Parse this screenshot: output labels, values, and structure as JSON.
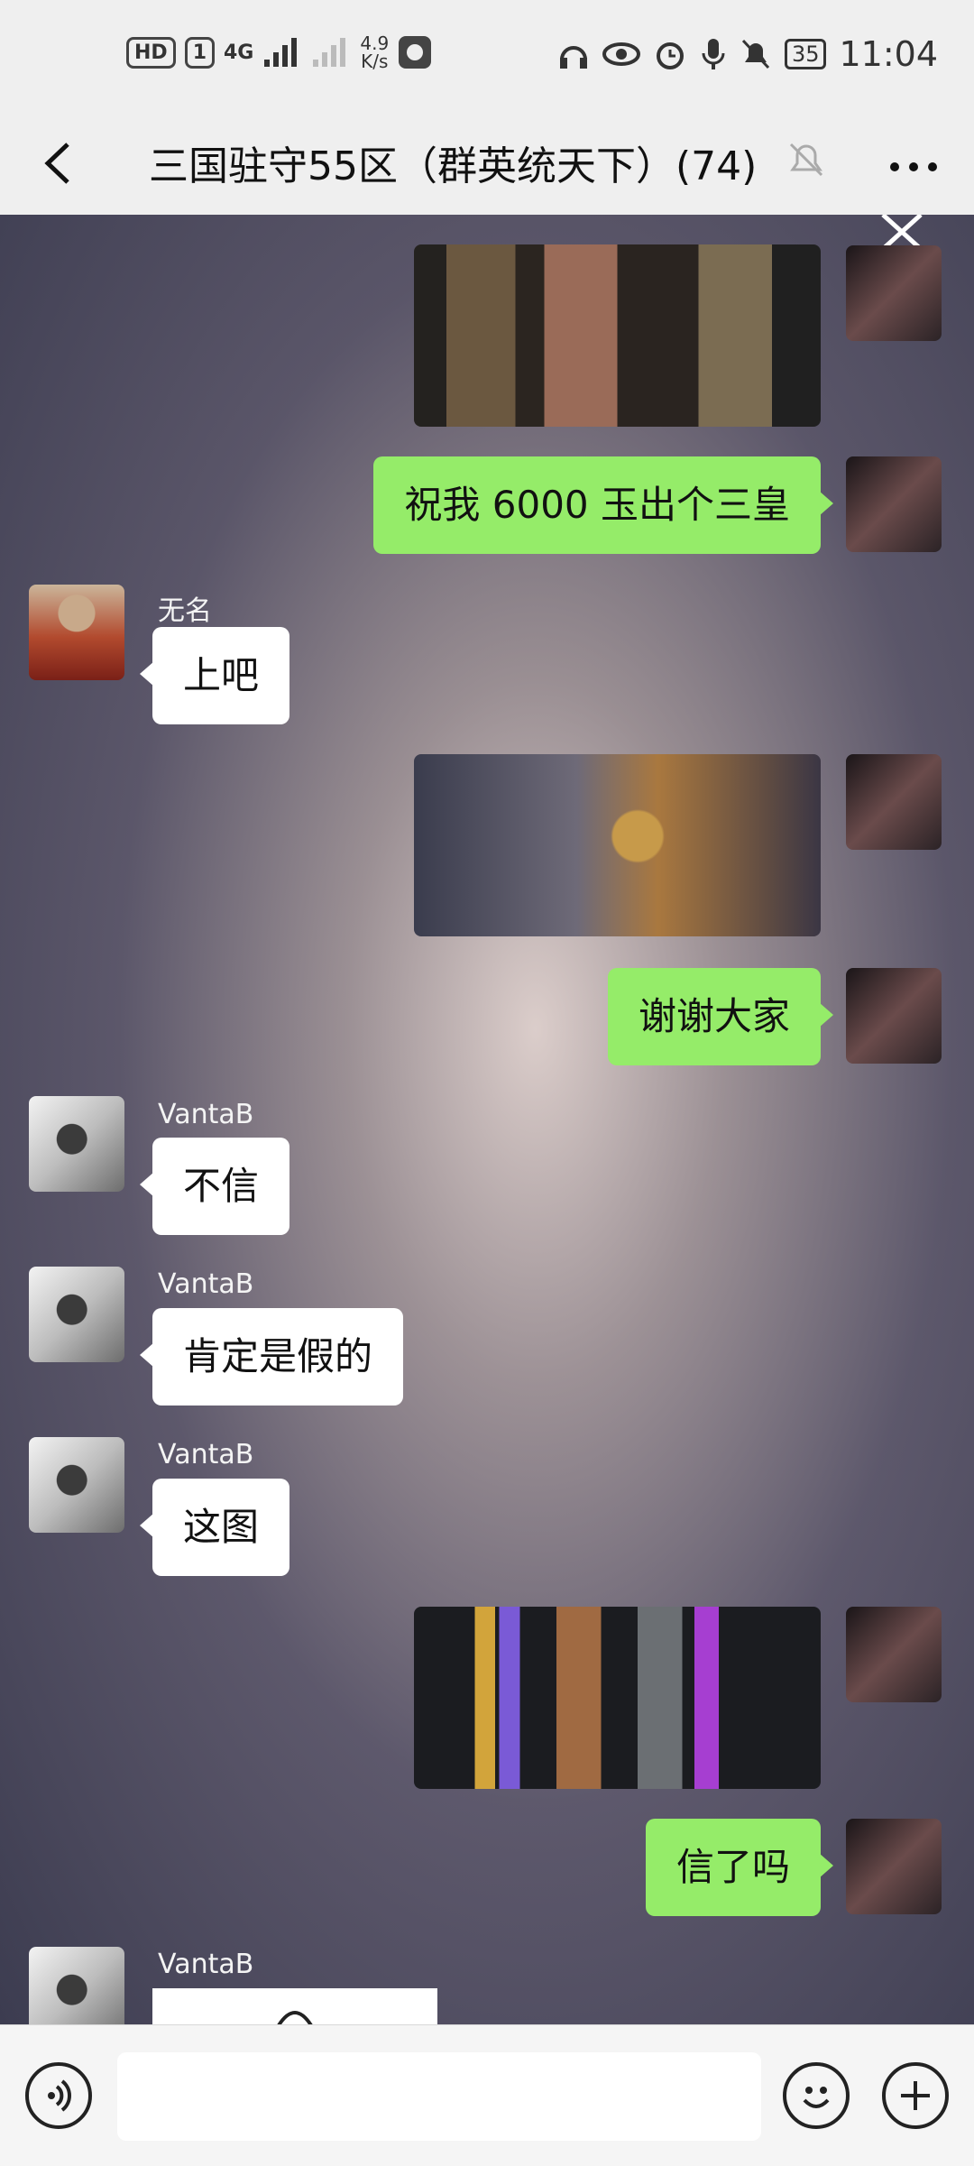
{
  "status_bar": {
    "hd": "HD",
    "sim": "1",
    "network_type": "4G",
    "speed_value": "4.9",
    "speed_unit": "K/s",
    "battery": "35",
    "time": "11:04"
  },
  "header": {
    "title": "三国驻守55区（群英统天下）(74)",
    "back_icon": "chevron-left-icon",
    "mute_icon": "bell-off-icon",
    "more_icon": "ellipsis-icon"
  },
  "messages": [
    {
      "type": "image",
      "sender": "me",
      "description_icon": "game-screenshot"
    },
    {
      "type": "text",
      "sender": "me",
      "text": "祝我 6000 玉出个三皇"
    },
    {
      "type": "text",
      "sender": "other",
      "name": "无名",
      "text": "上吧"
    },
    {
      "type": "image",
      "sender": "me",
      "description_icon": "game-screenshot"
    },
    {
      "type": "text",
      "sender": "me",
      "text": "谢谢大家"
    },
    {
      "type": "text",
      "sender": "other",
      "name": "VantaB",
      "text": "不信"
    },
    {
      "type": "text",
      "sender": "other",
      "name": "VantaB",
      "text": "肯定是假的"
    },
    {
      "type": "text",
      "sender": "other",
      "name": "VantaB",
      "text": "这图"
    },
    {
      "type": "image",
      "sender": "me",
      "description_icon": "game-screenshot"
    },
    {
      "type": "text",
      "sender": "me",
      "text": "信了吗"
    },
    {
      "type": "sticker",
      "sender": "other",
      "name": "VantaB"
    }
  ],
  "input_bar": {
    "voice_icon": "voice-icon",
    "emoji_icon": "emoji-icon",
    "plus_icon": "plus-icon",
    "placeholder": ""
  },
  "colors": {
    "my_bubble": "#95ec69",
    "other_bubble": "#ffffff",
    "bar_bg": "#efefef"
  }
}
